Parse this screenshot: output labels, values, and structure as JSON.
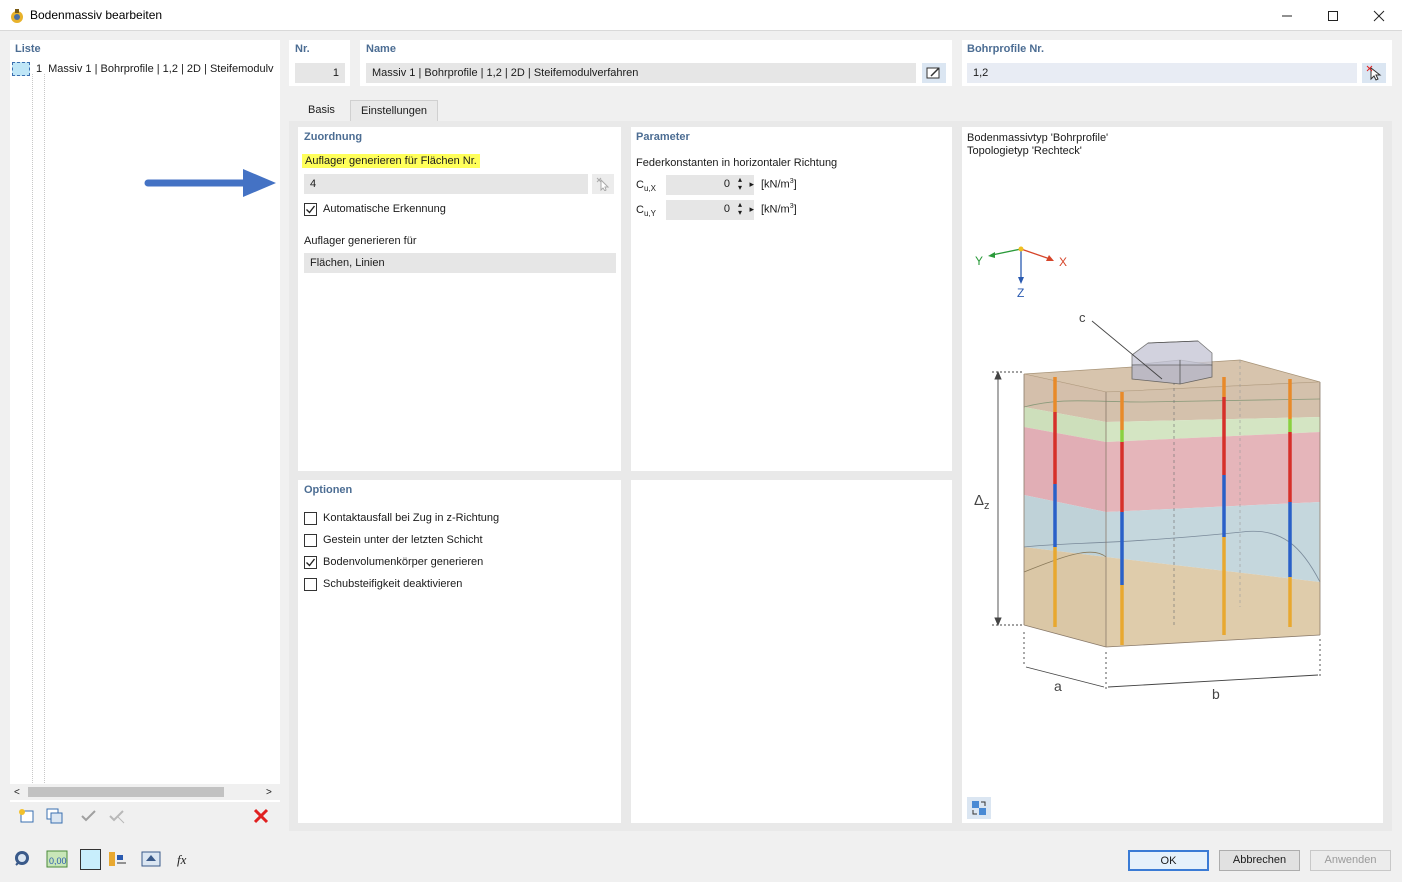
{
  "window": {
    "title": "Bodenmassiv bearbeiten"
  },
  "list": {
    "header": "Liste",
    "items": [
      {
        "number": "1",
        "label": "Massiv 1 | Bohrprofile | 1,2 | 2D | Steifemodulv"
      }
    ]
  },
  "header_fields": {
    "nr": {
      "label": "Nr.",
      "value": "1"
    },
    "name": {
      "label": "Name",
      "value": "Massiv 1 | Bohrprofile | 1,2 | 2D | Steifemodulverfahren"
    },
    "bohrprofile": {
      "label": "Bohrprofile Nr.",
      "value": "1,2"
    }
  },
  "tabs": [
    {
      "label": "Basis",
      "active": false
    },
    {
      "label": "Einstellungen",
      "active": true
    }
  ],
  "zuordnung": {
    "header": "Zuordnung",
    "flaechen_label": "Auflager generieren für Flächen Nr.",
    "flaechen_value": "4",
    "auto_label": "Automatische Erkennung",
    "auto_checked": true,
    "generieren_label": "Auflager generieren für",
    "generieren_value": "Flächen, Linien"
  },
  "parameter": {
    "header": "Parameter",
    "sub_label": "Federkonstanten in horizontaler Richtung",
    "rows": [
      {
        "symbol": "C",
        "subscript": "u,X",
        "value": "0",
        "unit": "[kN/m",
        "unit_exp": "3",
        "unit_close": "]"
      },
      {
        "symbol": "C",
        "subscript": "u,Y",
        "value": "0",
        "unit": "[kN/m",
        "unit_exp": "3",
        "unit_close": "]"
      }
    ]
  },
  "optionen": {
    "header": "Optionen",
    "items": [
      {
        "label": "Kontaktausfall bei Zug in z-Richtung",
        "checked": false
      },
      {
        "label": "Gestein unter der letzten Schicht",
        "checked": false
      },
      {
        "label": "Bodenvolumenkörper generieren",
        "checked": true
      },
      {
        "label": "Schubsteifigkeit deaktivieren",
        "checked": false
      }
    ]
  },
  "preview": {
    "line1": "Bodenmassivtyp 'Bohrprofile'",
    "line2": "Topologietyp 'Rechteck'",
    "axis_x": "X",
    "axis_y": "Y",
    "axis_z": "Z",
    "label_c": "c",
    "label_dz": "Δ",
    "label_dz_sub": "z",
    "label_a": "a",
    "label_b": "b"
  },
  "buttons": {
    "ok": "OK",
    "cancel": "Abbrechen",
    "apply": "Anwenden"
  },
  "colors": {
    "accent": "#4c6d93",
    "highlight": "#ffff5a",
    "arrow": "#4472c4",
    "delete": "#e02020"
  }
}
